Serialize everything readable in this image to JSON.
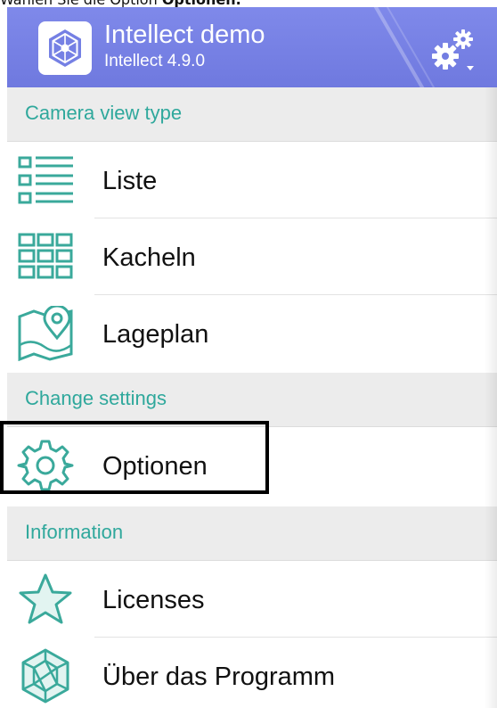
{
  "caption": {
    "prefix": "Wählen Sie die Option ",
    "bold": "Optionen."
  },
  "header": {
    "title": "Intellect demo",
    "version": "Intellect 4.9.0"
  },
  "sections": [
    {
      "title": "Camera view type",
      "items": [
        {
          "label": "Liste",
          "icon": "list-icon"
        },
        {
          "label": "Kacheln",
          "icon": "grid-icon"
        },
        {
          "label": "Lageplan",
          "icon": "map-pin-icon"
        }
      ]
    },
    {
      "title": "Change settings",
      "items": [
        {
          "label": "Optionen",
          "icon": "gear-icon"
        }
      ]
    },
    {
      "title": "Information",
      "items": [
        {
          "label": "Licenses",
          "icon": "star-icon"
        },
        {
          "label": "Über das Programm",
          "icon": "hexagon-icon"
        }
      ]
    }
  ],
  "colors": {
    "header": "#737de2",
    "section_text": "#2fa89c",
    "icon": "#3aa99b",
    "section_bg": "#ececec"
  }
}
